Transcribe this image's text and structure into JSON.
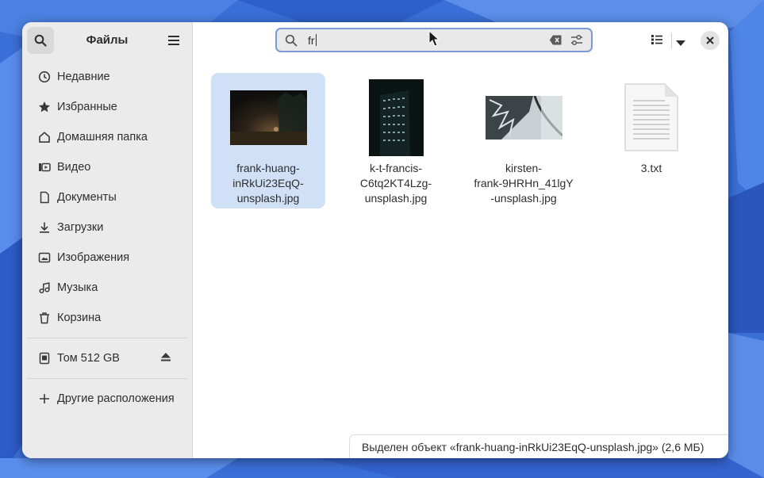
{
  "sidebar": {
    "title": "Файлы",
    "items": [
      {
        "label": "Недавние",
        "icon": "clock-icon"
      },
      {
        "label": "Избранные",
        "icon": "star-icon"
      },
      {
        "label": "Домашняя папка",
        "icon": "home-icon"
      },
      {
        "label": "Видео",
        "icon": "video-icon"
      },
      {
        "label": "Документы",
        "icon": "document-icon"
      },
      {
        "label": "Загрузки",
        "icon": "download-icon"
      },
      {
        "label": "Изображения",
        "icon": "image-icon"
      },
      {
        "label": "Музыка",
        "icon": "music-icon"
      },
      {
        "label": "Корзина",
        "icon": "trash-icon"
      }
    ],
    "volume": {
      "label": "Том 512 GB",
      "icon": "drive-icon"
    },
    "other_locations": {
      "label": "Другие расположения",
      "icon": "plus-icon"
    }
  },
  "search": {
    "query": "fr"
  },
  "files": [
    {
      "name": "frank-huang-\ninRkUi23EqQ-\nunsplash.jpg",
      "selected": true
    },
    {
      "name": "k-t-francis-\nC6tq2KT4Lzg-\nunsplash.jpg",
      "selected": false
    },
    {
      "name": "kirsten-\nfrank-9HRHn_41lgY\n-unsplash.jpg",
      "selected": false
    },
    {
      "name": "3.txt",
      "selected": false
    }
  ],
  "status": {
    "text": "Выделен объект «frank-huang-inRkUi23EqQ-unsplash.jpg» (2,6 МБ)"
  },
  "colors": {
    "accent": "#3584e4",
    "selection": "#cfe0f7",
    "sidebar_bg": "#ebebeb"
  }
}
